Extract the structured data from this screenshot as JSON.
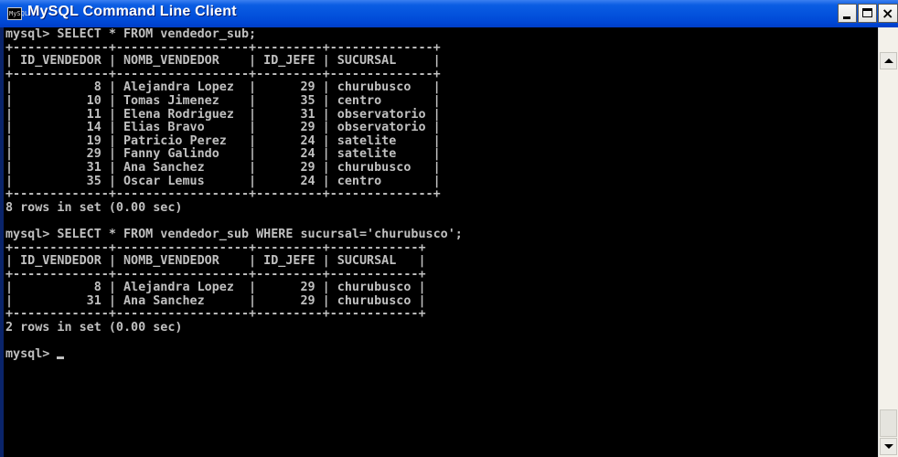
{
  "window": {
    "title": "MySQL Command Line Client",
    "icon_label": "MySQL",
    "icon_name": "console-app-icon",
    "buttons": {
      "minimize": "minimize",
      "maximize": "maximize",
      "close": "×"
    }
  },
  "console": {
    "lines": [
      "mysql> SELECT * FROM vendedor_sub;",
      "+-------------+------------------+---------+--------------+",
      "| ID_VENDEDOR | NOMB_VENDEDOR    | ID_JEFE | SUCURSAL     |",
      "+-------------+------------------+---------+--------------+",
      "|           8 | Alejandra Lopez  |      29 | churubusco   |",
      "|          10 | Tomas Jimenez    |      35 | centro       |",
      "|          11 | Elena Rodriguez  |      31 | observatorio |",
      "|          14 | Elias Bravo      |      29 | observatorio |",
      "|          19 | Patricio Perez   |      24 | satelite     |",
      "|          29 | Fanny Galindo    |      24 | satelite     |",
      "|          31 | Ana Sanchez      |      29 | churubusco   |",
      "|          35 | Oscar Lemus      |      24 | centro       |",
      "+-------------+------------------+---------+--------------+",
      "8 rows in set (0.00 sec)",
      "",
      "mysql> SELECT * FROM vendedor_sub WHERE sucursal='churubusco';",
      "+-------------+------------------+---------+------------+",
      "| ID_VENDEDOR | NOMB_VENDEDOR    | ID_JEFE | SUCURSAL   |",
      "+-------------+------------------+---------+------------+",
      "|           8 | Alejandra Lopez  |      29 | churubusco |",
      "|          31 | Ana Sanchez      |      29 | churubusco |",
      "+-------------+------------------+---------+------------+",
      "2 rows in set (0.00 sec)",
      "",
      "mysql> "
    ]
  },
  "colors": {
    "title_bar": "#0453dd",
    "console_background": "#000000",
    "console_text": "#c0c0c0"
  }
}
